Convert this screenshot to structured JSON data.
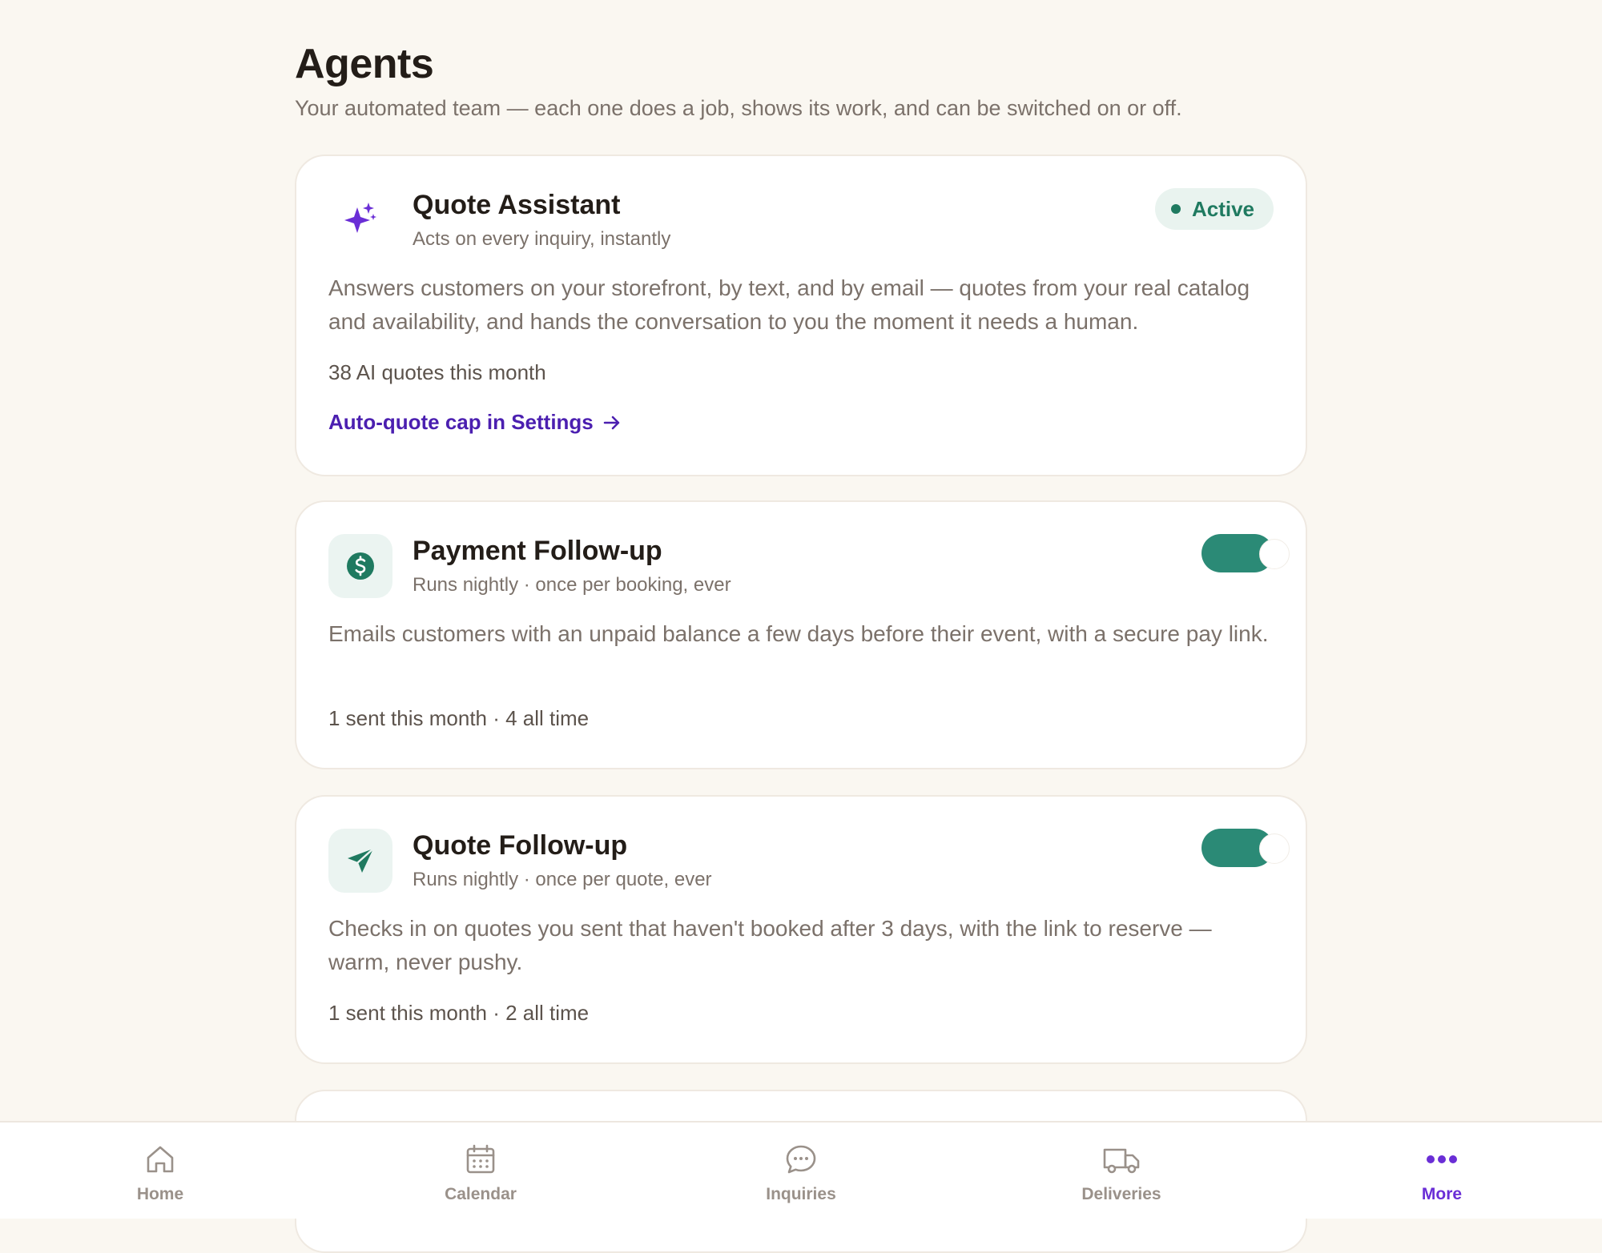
{
  "page": {
    "title": "Agents",
    "subtitle": "Your automated team — each one does a job, shows its work, and can be switched on or off."
  },
  "agents": [
    {
      "icon": "sparkle-icon",
      "title": "Quote Assistant",
      "subtitle": "Acts on every inquiry, instantly",
      "status": "Active",
      "description": "Answers customers on your storefront, by text, and by email — quotes from your real catalog and availability, and hands the conversation to you the moment it needs a human.",
      "stat": "38 AI quotes this month",
      "link": "Auto-quote cap in Settings"
    },
    {
      "icon": "dollar-icon",
      "title": "Payment Follow-up",
      "subtitle": "Runs nightly · once per booking, ever",
      "enabled": true,
      "description": "Emails customers with an unpaid balance a few days before their event, with a secure pay link.",
      "stat": "1 sent this month · 4 all time"
    },
    {
      "icon": "send-icon",
      "title": "Quote Follow-up",
      "subtitle": "Runs nightly · once per quote, ever",
      "enabled": true,
      "description": "Checks in on quotes you sent that haven't booked after 3 days, with the link to reserve — warm, never pushy.",
      "stat": "1 sent this month · 2 all time"
    }
  ],
  "colors": {
    "background": "#faf7f1",
    "accent_purple": "#6a2ed6",
    "accent_green": "#2b8a76",
    "link": "#4b1fb0"
  },
  "nav": {
    "items": [
      {
        "label": "Home",
        "icon": "home-icon"
      },
      {
        "label": "Calendar",
        "icon": "calendar-icon"
      },
      {
        "label": "Inquiries",
        "icon": "chat-bubble-icon"
      },
      {
        "label": "Deliveries",
        "icon": "truck-icon"
      },
      {
        "label": "More",
        "icon": "more-dots-icon",
        "active": true
      }
    ]
  }
}
